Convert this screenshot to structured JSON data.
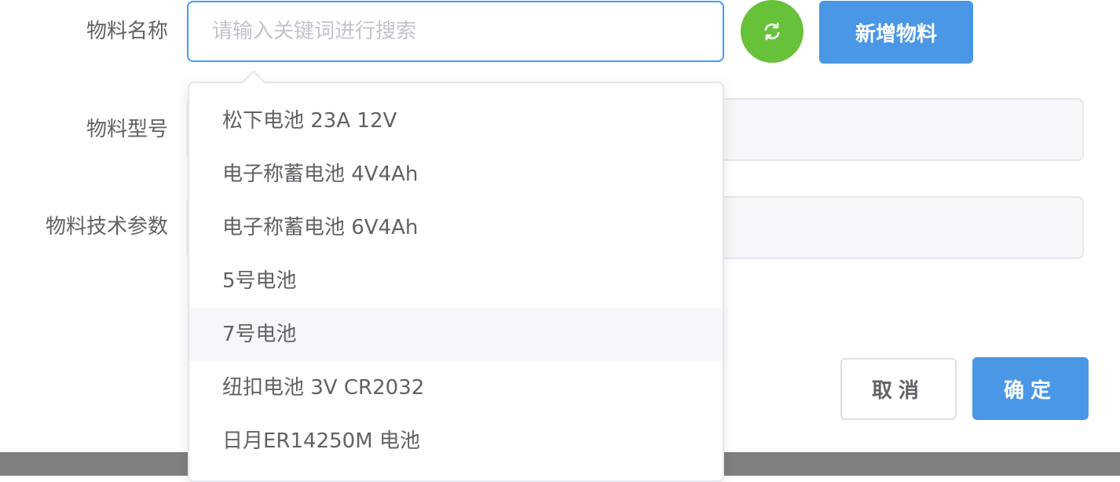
{
  "form": {
    "name_label": "物料名称",
    "model_label": "物料型号",
    "specs_label": "物料技术参数",
    "search_placeholder": "请输入关键词进行搜索",
    "add_button_label": "新增物料",
    "refresh_icon": "refresh-icon"
  },
  "dropdown": {
    "items": [
      "松下电池 23A 12V",
      "电子称蓄电池 4V4Ah",
      "电子称蓄电池 6V4Ah",
      "5号电池",
      "7号电池",
      "纽扣电池 3V CR2032",
      "日月ER14250M 电池"
    ],
    "highlighted_item": "7号电池"
  },
  "footer": {
    "cancel_label": "取消",
    "confirm_label": "确定"
  },
  "colors": {
    "primary": "#4a97e6",
    "focus_border": "#409eff",
    "success": "#67c23a",
    "text": "#606266",
    "placeholder": "#c0c4cc",
    "field_background": "#f5f7fa",
    "overlay": "#808080"
  }
}
